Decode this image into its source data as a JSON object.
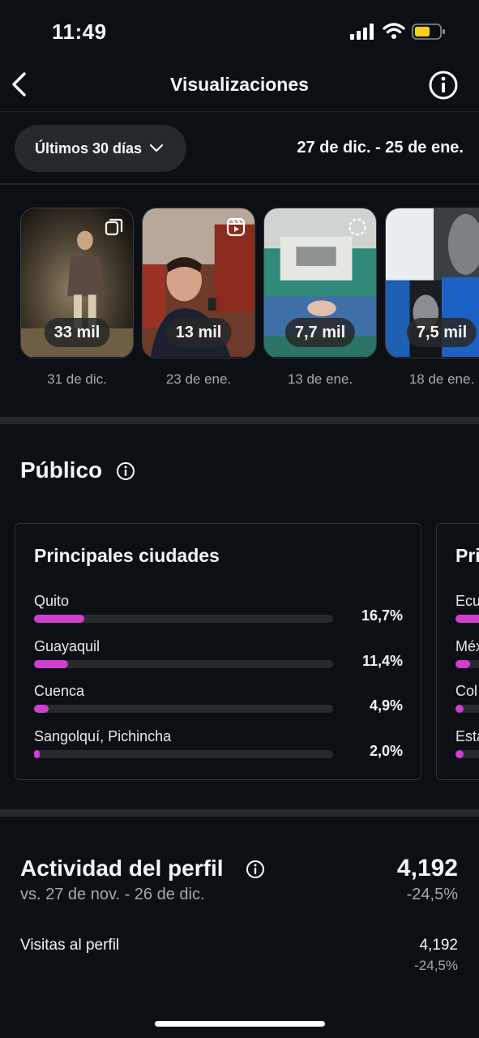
{
  "status_bar": {
    "time": "11:49"
  },
  "header": {
    "title": "Visualizaciones",
    "back_icon": "chevron-left-icon",
    "info_icon": "info-icon"
  },
  "filter": {
    "range_label": "Últimos 30 días",
    "date_range": "27 de dic. - 25 de ene."
  },
  "top_content": [
    {
      "views": "33 mil",
      "date": "31 de dic.",
      "type": "carousel"
    },
    {
      "views": "13 mil",
      "date": "23 de ene.",
      "type": "reel"
    },
    {
      "views": "7,7 mil",
      "date": "13 de ene.",
      "type": "story"
    },
    {
      "views": "7,5 mil",
      "date": "18 de ene.",
      "type": "story"
    }
  ],
  "audience": {
    "title": "Público",
    "cities_card": {
      "title": "Principales ciudades",
      "rows": [
        {
          "name": "Quito",
          "percent": "16,7%",
          "value": 16.7
        },
        {
          "name": "Guayaquil",
          "percent": "11,4%",
          "value": 11.4
        },
        {
          "name": "Cuenca",
          "percent": "4,9%",
          "value": 4.9
        },
        {
          "name": "Sangolquí, Pichincha",
          "percent": "2,0%",
          "value": 2.0
        }
      ]
    },
    "countries_card": {
      "title": "Pri",
      "rows": [
        "Ecu",
        "Méx",
        "Col",
        "Esta"
      ]
    }
  },
  "profile_activity": {
    "title": "Actividad del perfil",
    "comparison": "vs. 27 de nov. - 26 de dic.",
    "total": "4,192",
    "change": "-24,5%",
    "visits_label": "Visitas al perfil",
    "visits_value": "4,192",
    "visits_change": "-24,5%"
  },
  "colors": {
    "background": "#0c1014",
    "accent_bar": "#d03ed0",
    "track": "#26292e"
  }
}
